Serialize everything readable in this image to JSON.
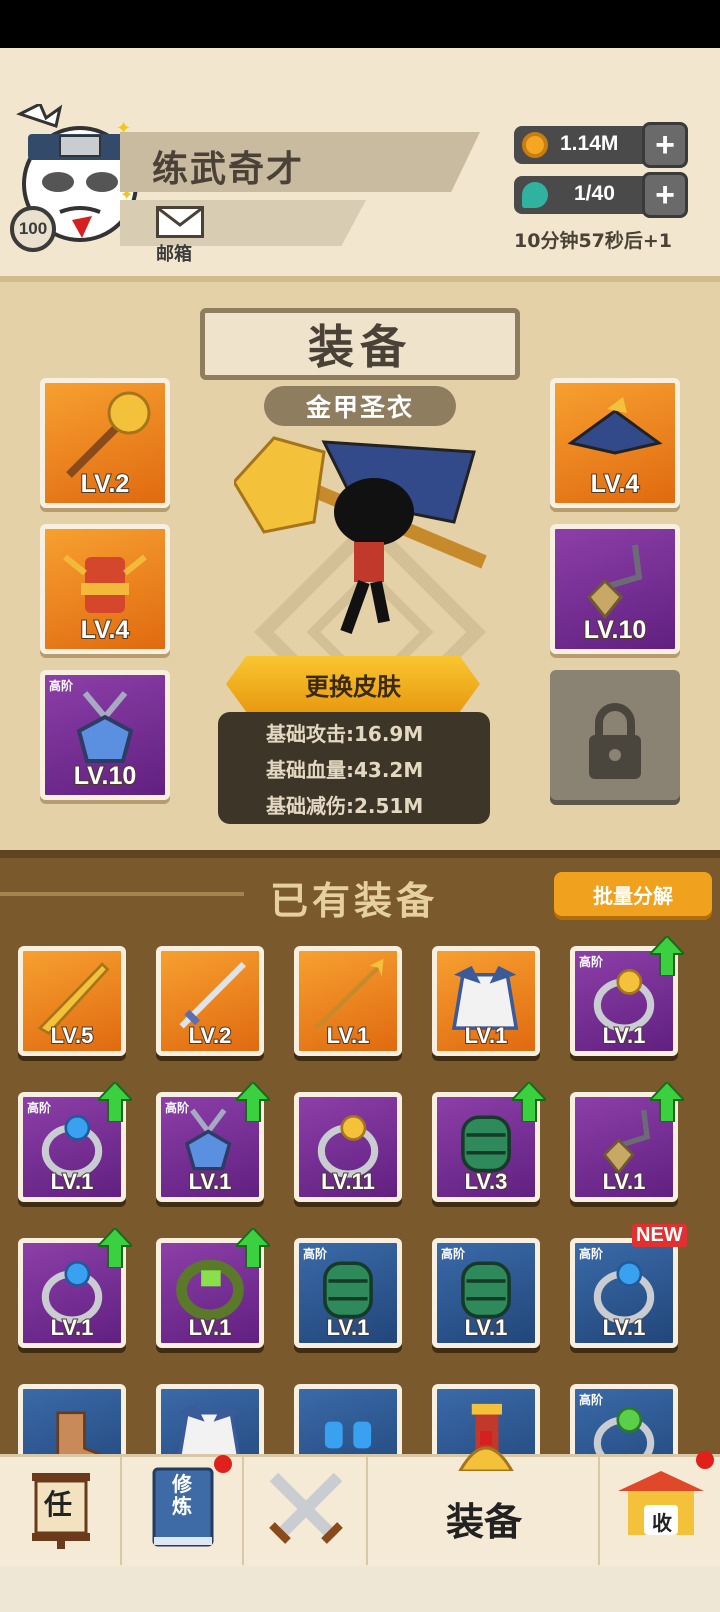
{
  "player": {
    "name": "练武奇才",
    "level": "100",
    "mail_label": "邮箱"
  },
  "resources": {
    "gold": "1.14M",
    "energy": "1/40",
    "energy_timer": "10分钟57秒后+1"
  },
  "equip": {
    "title": "装备",
    "skin_name": "金甲圣衣",
    "change_skin_label": "更换皮肤",
    "stats": [
      "基础攻击:16.9M",
      "基础血量:43.2M",
      "基础减伤:2.51M"
    ],
    "slots_left": [
      {
        "lv": "LV.2",
        "rarity": "orange",
        "icon": "mace-icon",
        "tier": ""
      },
      {
        "lv": "LV.4",
        "rarity": "orange",
        "icon": "armor-icon",
        "tier": ""
      },
      {
        "lv": "LV.10",
        "rarity": "purple",
        "icon": "pendant-icon",
        "tier": "高阶"
      }
    ],
    "slots_right": [
      {
        "lv": "LV.4",
        "rarity": "orange",
        "icon": "hat-icon",
        "tier": ""
      },
      {
        "lv": "LV.10",
        "rarity": "purple",
        "icon": "necklace-icon",
        "tier": ""
      },
      {
        "lv": "",
        "rarity": "locked",
        "icon": "lock-icon",
        "tier": ""
      }
    ]
  },
  "inventory": {
    "title": "已有装备",
    "batch_label": "批量分解",
    "items": [
      {
        "lv": "LV.5",
        "rarity": "orange",
        "icon": "saber-icon",
        "tier": "",
        "upgrade": false,
        "new": false
      },
      {
        "lv": "LV.2",
        "rarity": "orange",
        "icon": "sword-icon",
        "tier": "",
        "upgrade": false,
        "new": false
      },
      {
        "lv": "LV.1",
        "rarity": "orange",
        "icon": "spear-icon",
        "tier": "",
        "upgrade": false,
        "new": false
      },
      {
        "lv": "LV.1",
        "rarity": "orange",
        "icon": "robe-icon",
        "tier": "",
        "upgrade": false,
        "new": false
      },
      {
        "lv": "LV.1",
        "rarity": "purple",
        "icon": "ring-gold-icon",
        "tier": "高阶",
        "upgrade": true,
        "new": false
      },
      {
        "lv": "LV.1",
        "rarity": "purple",
        "icon": "ring-blue-icon",
        "tier": "高阶",
        "upgrade": true,
        "new": false
      },
      {
        "lv": "LV.1",
        "rarity": "purple",
        "icon": "pendant-icon",
        "tier": "高阶",
        "upgrade": true,
        "new": false
      },
      {
        "lv": "LV.11",
        "rarity": "purple",
        "icon": "ring-gold-icon",
        "tier": "",
        "upgrade": false,
        "new": false
      },
      {
        "lv": "LV.3",
        "rarity": "purple",
        "icon": "bracer-icon",
        "tier": "",
        "upgrade": true,
        "new": false
      },
      {
        "lv": "LV.1",
        "rarity": "purple",
        "icon": "necklace-icon",
        "tier": "",
        "upgrade": true,
        "new": false
      },
      {
        "lv": "LV.1",
        "rarity": "purple",
        "icon": "ring-blue-icon",
        "tier": "",
        "upgrade": true,
        "new": false
      },
      {
        "lv": "LV.1",
        "rarity": "purple",
        "icon": "bracelet-icon",
        "tier": "",
        "upgrade": true,
        "new": false
      },
      {
        "lv": "LV.1",
        "rarity": "blue",
        "icon": "bracer-icon",
        "tier": "高阶",
        "upgrade": false,
        "new": false
      },
      {
        "lv": "LV.1",
        "rarity": "blue",
        "icon": "bracer-icon",
        "tier": "高阶",
        "upgrade": false,
        "new": false
      },
      {
        "lv": "LV.1",
        "rarity": "blue",
        "icon": "ring-blue-icon",
        "tier": "高阶",
        "upgrade": false,
        "new": true
      },
      {
        "lv": "",
        "rarity": "blue",
        "icon": "boot-icon",
        "tier": "",
        "upgrade": false,
        "new": false
      },
      {
        "lv": "",
        "rarity": "blue",
        "icon": "robe-icon",
        "tier": "",
        "upgrade": false,
        "new": false
      },
      {
        "lv": "",
        "rarity": "blue",
        "icon": "glove-icon",
        "tier": "",
        "upgrade": false,
        "new": false
      },
      {
        "lv": "",
        "rarity": "blue",
        "icon": "armor-icon",
        "tier": "",
        "upgrade": false,
        "new": false
      },
      {
        "lv": "",
        "rarity": "blue",
        "icon": "ring-green-icon",
        "tier": "高阶",
        "upgrade": false,
        "new": false
      }
    ],
    "new_label": "NEW"
  },
  "nav": {
    "task_glyph": "任",
    "train_glyph": "修炼",
    "equip_label": "装备",
    "collect_glyph": "收"
  },
  "colors": {
    "orange": "#f08a20",
    "purple": "#7a2e98",
    "blue": "#2e5a95",
    "accent": "#f0a21f"
  }
}
